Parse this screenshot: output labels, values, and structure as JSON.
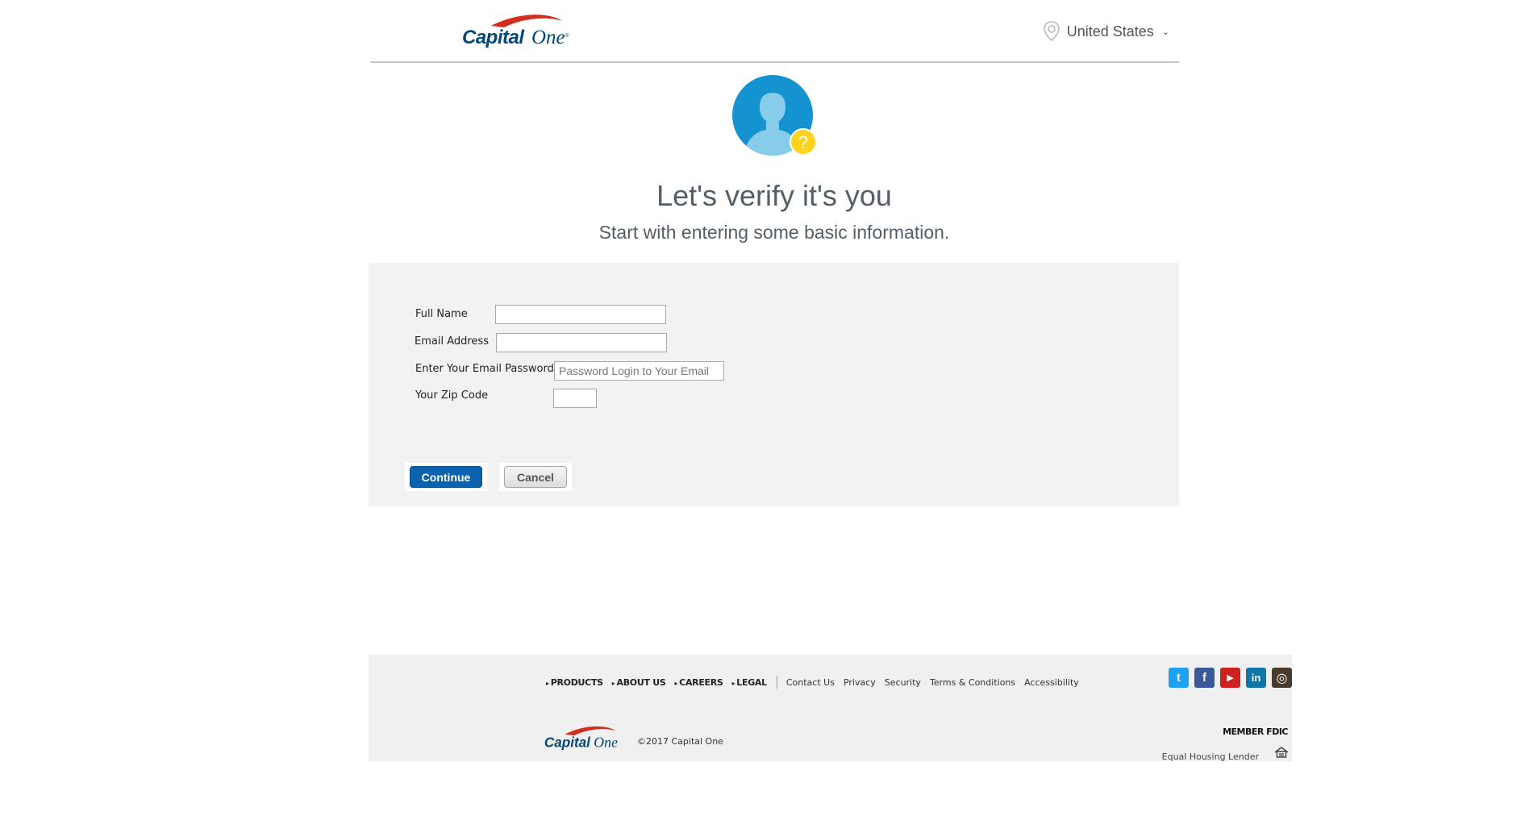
{
  "header": {
    "brand": "Capital One",
    "country": "United States"
  },
  "main": {
    "title": "Let's verify it's you",
    "subtitle": "Start with entering some basic information."
  },
  "form": {
    "full_name_label": "Full Name",
    "full_name_value": "",
    "email_label": "Email Address",
    "email_value": "",
    "password_label": "Enter Your Email Password",
    "password_placeholder": "Password Login to Your Email",
    "zip_label": "Your Zip Code",
    "zip_value": "",
    "continue_label": "Continue",
    "cancel_label": "Cancel"
  },
  "footer": {
    "main_links": [
      "PRODUCTS",
      "ABOUT US",
      "CAREERS",
      "LEGAL"
    ],
    "sub_links": [
      "Contact Us",
      "Privacy",
      "Security",
      "Terms & Conditions",
      "Accessibility"
    ],
    "social": [
      {
        "name": "twitter-icon",
        "glyph": "t",
        "color": "#1da1f2"
      },
      {
        "name": "facebook-icon",
        "glyph": "f",
        "color": "#3b5998"
      },
      {
        "name": "youtube-icon",
        "glyph": "▶",
        "color": "#cd201f"
      },
      {
        "name": "linkedin-icon",
        "glyph": "in",
        "color": "#0e76a8"
      },
      {
        "name": "instagram-icon",
        "glyph": "◎",
        "color": "#4a3a2d"
      }
    ],
    "copyright": "©2017 Capital One",
    "member_fdic": "MEMBER FDIC",
    "equal_housing": "Equal Housing Lender"
  },
  "colors": {
    "accent": "#0b62ae",
    "avatar_bg": "#1592d0",
    "avatar_figure": "#87cdea",
    "question_badge": "#ffd21f",
    "brand_red": "#d22e1e",
    "brand_navy": "#004879"
  }
}
